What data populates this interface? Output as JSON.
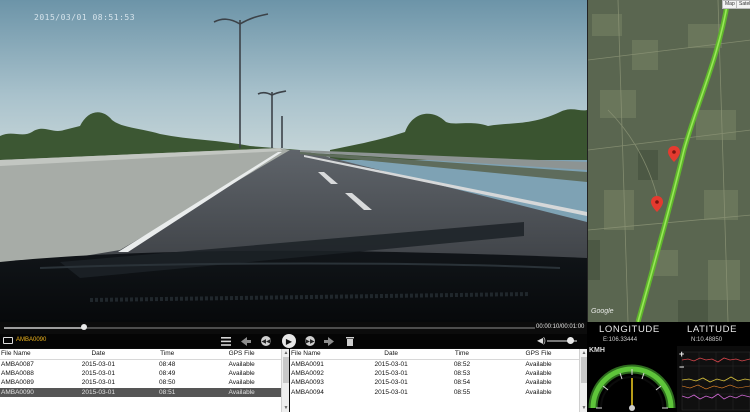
{
  "video": {
    "timestamp": "2015/03/01 08:51:53"
  },
  "map": {
    "buttons": [
      "Map",
      "Satellite"
    ],
    "attribution": "Google"
  },
  "player": {
    "time": "00:00:10/00:01:00",
    "progress": 0.15,
    "volume": 0.75,
    "current_file": "AMBA0090"
  },
  "files_left": {
    "headers": [
      "File Name",
      "Date",
      "Time",
      "GPS File"
    ],
    "rows": [
      [
        "AMBA0087",
        "2015-03-01",
        "08:48",
        "Available"
      ],
      [
        "AMBA0088",
        "2015-03-01",
        "08:49",
        "Available"
      ],
      [
        "AMBA0089",
        "2015-03-01",
        "08:50",
        "Available"
      ],
      [
        "AMBA0090",
        "2015-03-01",
        "08:51",
        "Available"
      ]
    ],
    "selected_index": 3
  },
  "files_right": {
    "headers": [
      "File Name",
      "Date",
      "Time",
      "GPS File"
    ],
    "rows": [
      [
        "AMBA0091",
        "2015-03-01",
        "08:52",
        "Available"
      ],
      [
        "AMBA0092",
        "2015-03-01",
        "08:53",
        "Available"
      ],
      [
        "AMBA0093",
        "2015-03-01",
        "08:54",
        "Available"
      ],
      [
        "AMBA0094",
        "2015-03-01",
        "08:55",
        "Available"
      ]
    ]
  },
  "gps": {
    "longitude_label": "LONGITUDE",
    "latitude_label": "LATITUDE",
    "longitude_value": "E:106.33444",
    "latitude_value": "N:10.48850"
  },
  "speed": {
    "unit_label": "KMH",
    "needle_fraction": 0.5
  },
  "gsensor": {
    "zoom_in": "+",
    "zoom_out": "−"
  },
  "colors": {
    "accent_file": "#f1b61d",
    "route": "#76d13a",
    "marker": "#e53a2f",
    "selected_row": "#555555"
  }
}
